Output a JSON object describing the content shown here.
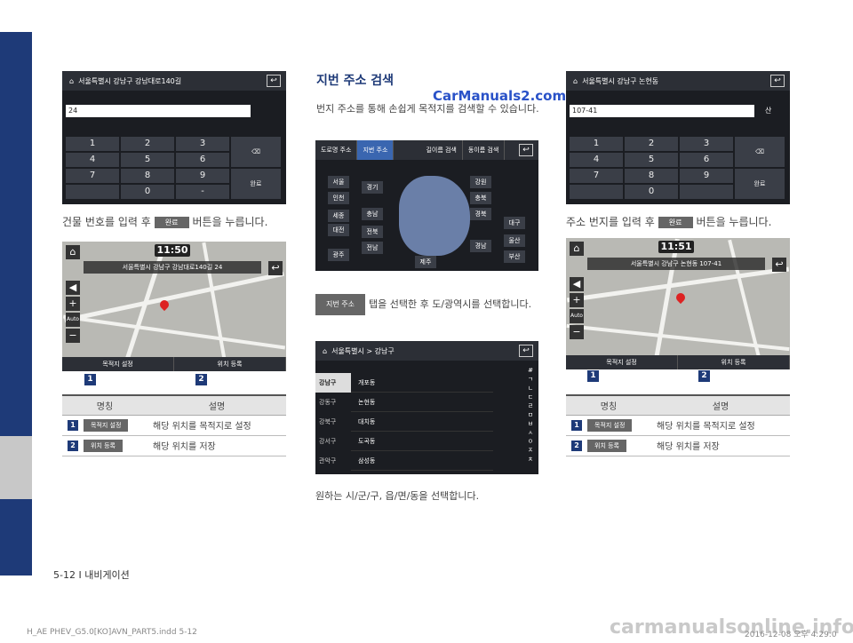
{
  "left": {
    "screen1": {
      "address": "서울특별시 강남구 강남대로140길",
      "input": "24",
      "keys": [
        "1",
        "2",
        "3",
        "4",
        "5",
        "6",
        "7",
        "8",
        "9",
        "",
        "0",
        "-"
      ],
      "done": "완료"
    },
    "caption1_pre": "건물 번호를 입력 후",
    "caption1_pill": "완료",
    "caption1_post": "버튼을 누릅니다.",
    "map": {
      "time": "11:50",
      "address": "서울특별시 강남구 강남대로140길 24",
      "btn1": "목적지 설정",
      "btn2": "위치 등록",
      "auto": "Auto",
      "navi": "NAVI"
    },
    "nums": [
      "1",
      "2"
    ],
    "table": {
      "h1": "명칭",
      "h2": "설명",
      "rows": [
        {
          "n": "1",
          "pill": "목적지 설정",
          "desc": "해당 위치를 목적지로 설정"
        },
        {
          "n": "2",
          "pill": "위치 등록",
          "desc": "해당 위치를 저장"
        }
      ]
    }
  },
  "middle": {
    "title": "지번 주소 검색",
    "body": "번지 주소를 통해 손쉽게 목적지를 검색할 수 있습니다.",
    "watermark": "CarManuals2.com",
    "tabs": [
      "도로명 주소",
      "지번 주소",
      "길이름 검색",
      "동이름 검색"
    ],
    "regions_left": [
      "서울",
      "인천",
      "세종",
      "대전",
      "광주"
    ],
    "regions_mid": [
      "경기",
      "충남",
      "전북",
      "전남"
    ],
    "regions_right": [
      "강원",
      "충북",
      "경북",
      "대구",
      "울산",
      "경남",
      "부산"
    ],
    "region_jeju": "제주",
    "caption2_pill": "지번 주소",
    "caption2": "탭을 선택한 후 도/광역시를 선택합니다.",
    "list": {
      "path": "서울특별시 > 강남구",
      "left": [
        "강남구",
        "강동구",
        "강북구",
        "강서구",
        "관악구"
      ],
      "right": [
        "개포동",
        "논현동",
        "대치동",
        "도곡동",
        "삼성동"
      ],
      "alpha": [
        "#",
        "ㄱ",
        "ㄴ",
        "ㄷ",
        "ㄹ",
        "ㅁ",
        "ㅂ",
        "ㅅ",
        "ㅇ",
        "ㅈ",
        "ㅊ"
      ]
    },
    "caption3": "원하는 시/군/구, 읍/면/동을 선택합니다."
  },
  "right": {
    "screen1": {
      "address": "서울특별시 강남구 논현동",
      "input": "107-41",
      "mountain": "산",
      "keys": [
        "1",
        "2",
        "3",
        "4",
        "5",
        "6",
        "7",
        "8",
        "9",
        "",
        "0",
        ""
      ],
      "done": "완료"
    },
    "caption1_pre": "주소 번지를 입력 후",
    "caption1_pill": "완료",
    "caption1_post": "버튼을 누릅니다.",
    "map": {
      "time": "11:51",
      "address": "서울특별시 강남구 논현동 107-41",
      "btn1": "목적지 설정",
      "btn2": "위치 등록",
      "auto": "Auto",
      "navi": "NAVI"
    },
    "nums": [
      "1",
      "2"
    ],
    "table": {
      "h1": "명칭",
      "h2": "설명",
      "rows": [
        {
          "n": "1",
          "pill": "목적지 설정",
          "desc": "해당 위치를 목적지로 설정"
        },
        {
          "n": "2",
          "pill": "위치 등록",
          "desc": "해당 위치를 저장"
        }
      ]
    }
  },
  "footer": {
    "page": "5-12 I 내비게이션",
    "file": "H_AE PHEV_G5.0[KO]AVN_PART5.indd   5-12",
    "date": "2016-12-08  오후 4:29:0",
    "watermark": "carmanualsonline.info"
  }
}
